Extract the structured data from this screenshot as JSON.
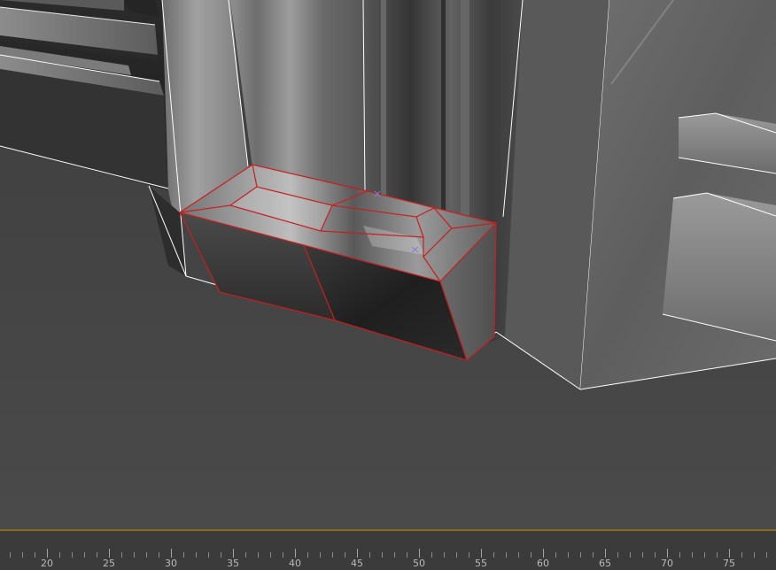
{
  "viewport": {
    "selection_color": "#c81e1e",
    "edge_color": "#ffffff",
    "background_color": "#444444"
  },
  "timeline": {
    "track_color": "#8a6b1c",
    "frame_start": 17,
    "frame_end": 78,
    "major_step": 5,
    "tick_labels": [
      "20",
      "25",
      "30",
      "35",
      "40",
      "45",
      "50",
      "55",
      "60",
      "65",
      "70",
      "75"
    ]
  }
}
